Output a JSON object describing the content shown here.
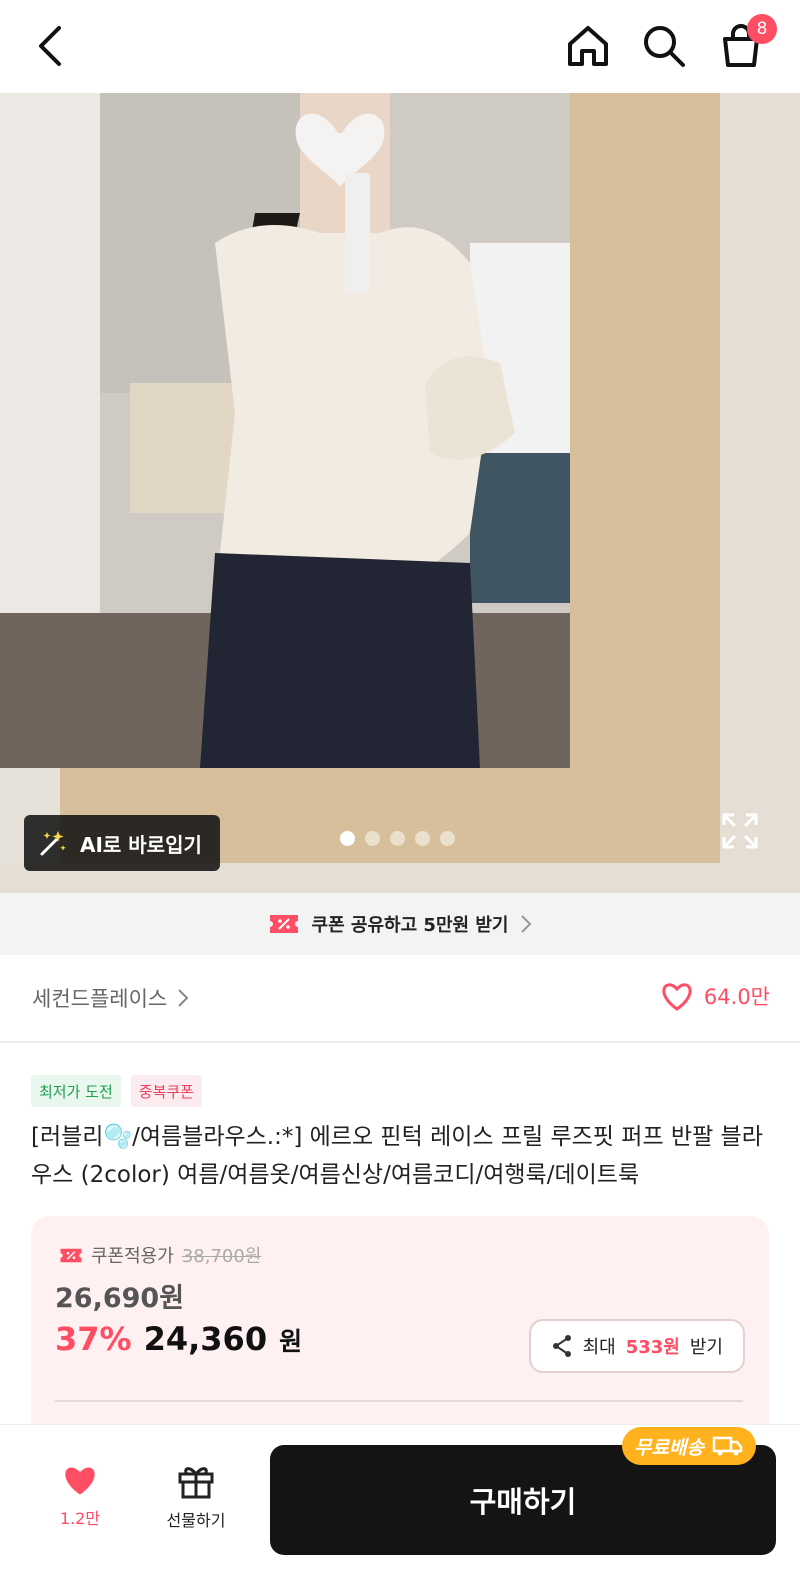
{
  "header": {
    "cart_count": "8",
    "icons": [
      "chevron-left-icon",
      "home-icon",
      "search-icon",
      "shopping-bag-icon"
    ]
  },
  "hero": {
    "ai_button_label": "AI로 바로입기",
    "slide_count": 5,
    "active_slide": 1
  },
  "coupon_bar": {
    "text": "쿠폰 공유하고 5만원 받기"
  },
  "store": {
    "name": "세컨드플레이스",
    "likes": "64.0만"
  },
  "product": {
    "tags": [
      "최저가 도전",
      "중복쿠폰"
    ],
    "title": "[러블리🫧/여름블라우스.:*] 에르오 핀턱 레이스 프릴 루즈핏 퍼프 반팔 블라우스 (2color) 여름/여름옷/여름신상/여름코디/여행룩/데이트룩"
  },
  "price": {
    "coupon_label": "쿠폰적용가",
    "original": "38,700원",
    "discounted": "26,690원",
    "percent": "37%",
    "final": "24,360",
    "currency": "원",
    "share_prefix": "최대",
    "share_amount": "533원",
    "share_suffix": "받기"
  },
  "bottom_bar": {
    "like_count": "1.2만",
    "gift_label": "선물하기",
    "buy_label": "구매하기",
    "free_shipping": "무료배송"
  },
  "colors": {
    "accent": "#ff4d63",
    "buy_button": "#141414",
    "free_ship": "#ffb21d"
  }
}
